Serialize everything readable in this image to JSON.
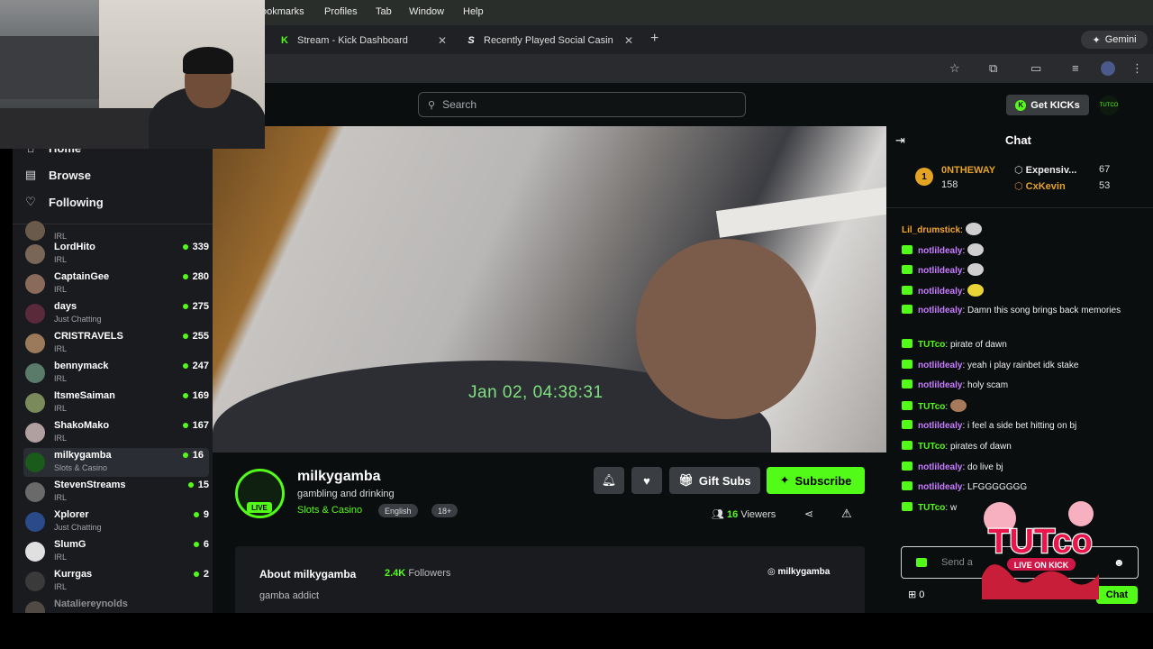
{
  "menubar": {
    "items": [
      "ookmarks",
      "Profiles",
      "Tab",
      "Window",
      "Help"
    ]
  },
  "tabs": [
    {
      "label": "Stream - Kick Dashboard",
      "favicon": "kick-icon"
    },
    {
      "label": "Recently Played Social Casin",
      "favicon": "stake-icon"
    }
  ],
  "browser": {
    "gemini_label": "Gemini"
  },
  "header": {
    "search_placeholder": "Search",
    "get_kicks_label": "Get KICKs",
    "avatar_text": "TUTCO"
  },
  "sidebar": {
    "nav": [
      {
        "label": "Home",
        "icon": "home-icon"
      },
      {
        "label": "Browse",
        "icon": "browse-icon"
      },
      {
        "label": "Following",
        "icon": "heart-icon"
      }
    ],
    "channels": [
      {
        "name": "",
        "category": "IRL",
        "count": ""
      },
      {
        "name": "LordHito",
        "category": "IRL",
        "count": "339"
      },
      {
        "name": "CaptainGee",
        "category": "IRL",
        "count": "280"
      },
      {
        "name": "days",
        "category": "Just Chatting",
        "count": "275"
      },
      {
        "name": "CRISTRAVELS",
        "category": "IRL",
        "count": "255"
      },
      {
        "name": "bennymack",
        "category": "IRL",
        "count": "247"
      },
      {
        "name": "ItsmeSaiman",
        "category": "IRL",
        "count": "169"
      },
      {
        "name": "ShakoMako",
        "category": "IRL",
        "count": "167"
      },
      {
        "name": "milkygamba",
        "category": "Slots & Casino",
        "count": "16"
      },
      {
        "name": "StevenStreams",
        "category": "IRL",
        "count": "15"
      },
      {
        "name": "Xplorer",
        "category": "Just Chatting",
        "count": "9"
      },
      {
        "name": "SlumG",
        "category": "IRL",
        "count": "6"
      },
      {
        "name": "Kurrgas",
        "category": "IRL",
        "count": "2"
      },
      {
        "name": "Nataliereynolds",
        "category": "",
        "count": ""
      }
    ]
  },
  "video": {
    "timestamp": "Jan 02, 04:38:31"
  },
  "channel": {
    "name": "milkygamba",
    "live_label": "LIVE",
    "stream_title": "gambling and drinking",
    "category": "Slots & Casino",
    "tags": [
      "English",
      "18+"
    ],
    "gift_subs_label": "Gift Subs",
    "subscribe_label": "Subscribe",
    "viewers_count": "16",
    "viewers_label": "Viewers"
  },
  "about": {
    "title": "About milkygamba",
    "followers_count": "2.4K",
    "followers_label": "Followers",
    "bio": "gamba addict",
    "instagram": "milkygamba"
  },
  "chat": {
    "title": "Chat",
    "leaderboard": [
      {
        "rank": "1",
        "name": "0NTHEWAY",
        "value": "158"
      },
      {
        "name": "Expensiv...",
        "value": "67"
      },
      {
        "name": "CxKevin",
        "value": "53"
      }
    ],
    "messages": [
      {
        "user": "Lil_drumstick",
        "text": ""
      },
      {
        "user": "notlildealy",
        "text": ""
      },
      {
        "user": "notlildealy",
        "text": ""
      },
      {
        "user": "notlildealy",
        "text": ""
      },
      {
        "user": "notlildealy",
        "text": "Damn this song brings back memories"
      },
      {
        "user": "TUTco",
        "text": "pirate of dawn"
      },
      {
        "user": "notlildealy",
        "text": "yeah i play rainbet idk stake"
      },
      {
        "user": "notlildealy",
        "text": "holy scam"
      },
      {
        "user": "TUTco",
        "text": ""
      },
      {
        "user": "notlildealy",
        "text": "i feel a side bet hitting on bj"
      },
      {
        "user": "TUTco",
        "text": "pirates of dawn"
      },
      {
        "user": "notlildealy",
        "text": "do live bj"
      },
      {
        "user": "notlildealy",
        "text": "LFGGGGGGG"
      },
      {
        "user": "TUTco",
        "text": "w"
      }
    ],
    "send_placeholder": "Send a",
    "points": "0",
    "chat_button_label": "Chat"
  },
  "overlay": {
    "logo_text": "TUTco",
    "logo_sub": "LIVE ON KICK"
  },
  "colors": {
    "kick_green": "#53fc18",
    "sidebar_bg": "#191b1f",
    "page_bg": "#0b0e0f"
  }
}
